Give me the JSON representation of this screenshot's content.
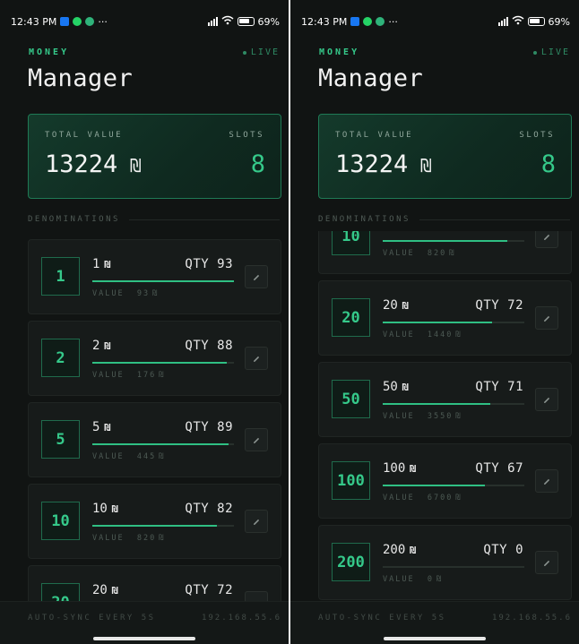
{
  "status": {
    "time": "12:43 PM",
    "battery": "69%"
  },
  "app": {
    "brand": "MONEY",
    "title": "Manager",
    "live": "LIVE",
    "total_label": "TOTAL VALUE",
    "total_value": "13224",
    "currency": "₪",
    "slots_label": "SLOTS",
    "slots_value": "8",
    "section_label": "DENOMINATIONS",
    "qty_label": "QTY",
    "value_label": "VALUE",
    "footer_sync": "AUTO-SYNC EVERY 5S",
    "footer_ip": "192.168.55.6"
  },
  "colors": {
    "accent": "#35c98a",
    "background": "#111413",
    "card": "#171b1a"
  },
  "denominations": [
    {
      "denom": "1",
      "qty": "93",
      "value": "93",
      "fill": 1.0
    },
    {
      "denom": "2",
      "qty": "88",
      "value": "176",
      "fill": 0.95
    },
    {
      "denom": "5",
      "qty": "89",
      "value": "445",
      "fill": 0.96
    },
    {
      "denom": "10",
      "qty": "82",
      "value": "820",
      "fill": 0.88
    },
    {
      "denom": "20",
      "qty": "72",
      "value": "1440",
      "fill": 0.77
    },
    {
      "denom": "50",
      "qty": "71",
      "value": "3550",
      "fill": 0.76
    },
    {
      "denom": "100",
      "qty": "67",
      "value": "6700",
      "fill": 0.72
    },
    {
      "denom": "200",
      "qty": "0",
      "value": "0",
      "fill": 0.0
    }
  ]
}
